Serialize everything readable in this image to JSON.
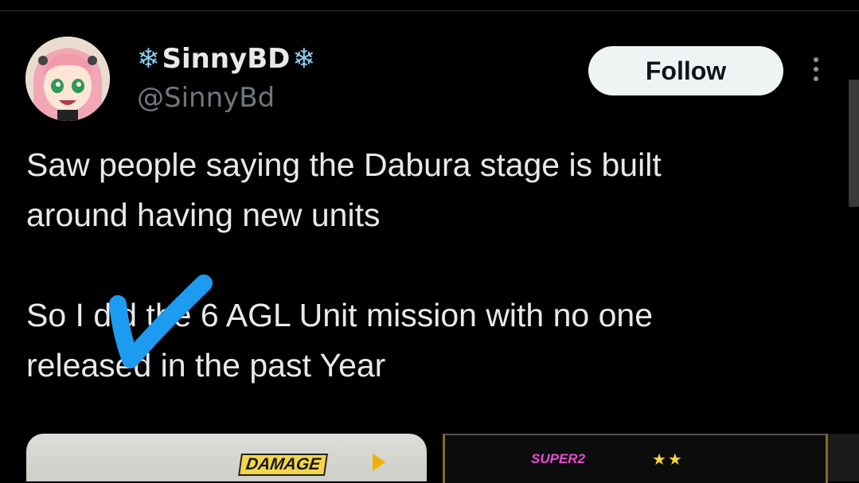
{
  "author": {
    "snowflake": "❄",
    "display_name": "SinnyBD",
    "handle": "@SinnyBd"
  },
  "follow_label": "Follow",
  "tweet": {
    "paragraph1": "Saw people saying the Dabura stage is built\naround having new units",
    "paragraph2": "So I did the 6 AGL Unit mission with no one\nreleased in the past Year"
  },
  "media": {
    "left_label": "DAMAGE",
    "right_label": "SUPER2",
    "right_stars": "★★"
  },
  "colors": {
    "accent_blue": "#1d9bf0",
    "follow_bg": "#eff3f4",
    "snowflake": "#8ecdf0"
  }
}
